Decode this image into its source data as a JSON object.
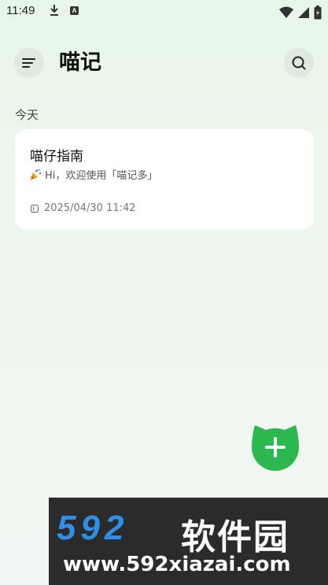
{
  "status_bar": {
    "time": "11:49",
    "download_icon": "download-icon",
    "a_badge": "A"
  },
  "header": {
    "title": "喵记",
    "menu_icon": "menu-icon",
    "search_icon": "search-icon"
  },
  "section": {
    "label": "今天"
  },
  "notes": [
    {
      "title": "喵仔指南",
      "preview": "Hi，欢迎使用「喵记多」",
      "preview_icon": "party-popper-icon",
      "date": "2025/04/30 11:42",
      "date_icon": "clock-icon"
    }
  ],
  "fab": {
    "icon": "plus-icon",
    "color": "#2db84f"
  },
  "watermark": {
    "number": "592",
    "name": "软件园",
    "url": "www.592xiazai.com"
  },
  "colors": {
    "background": "#eef6ee",
    "card": "#ffffff",
    "accent": "#2db84f"
  }
}
